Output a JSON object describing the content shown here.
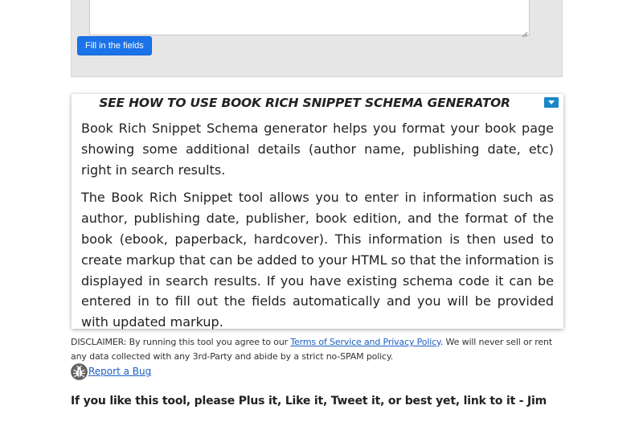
{
  "form": {
    "textarea_value": "",
    "fill_button_label": "Fill in the fields"
  },
  "howto": {
    "title": "SEE HOW TO USE BOOK RICH SNIPPET SCHEMA GENERATOR",
    "toggle_icon": "caret-down-icon",
    "paragraphs": [
      "Book Rich Snippet Schema generator helps you format your book page showing some additional details (author name, publishing date, etc) right in search results.",
      "The Book Rich Snippet tool allows you to enter in information such as author, publishing date, publisher, book edition, and the format of the book (ebook, paperback, hardcover). This information is then used to create markup that can be added to your HTML so that the information is displayed in search results. If you have existing schema code it can be entered in to fill out the fields automatically and you will be provided with updated markup."
    ]
  },
  "disclaimer": {
    "prefix": "DISCLAIMER: By running this tool you agree to our ",
    "link_label": "Terms of Service and Privacy Policy",
    "suffix": ". We will never sell or rent any data collected with any 3rd-Party and abide by a strict no-SPAM policy."
  },
  "report_bug": {
    "icon": "bug-icon",
    "label": "Report a Bug"
  },
  "plug": {
    "text": "If you like this tool, please Plus it, Like it, Tweet it, or best yet, link to it - Jim"
  },
  "colors": {
    "primary_button": "#1a73e8",
    "toggle_button": "#1a86c8",
    "link": "#1a5fc4",
    "panel_bg": "#e6e6e6"
  }
}
